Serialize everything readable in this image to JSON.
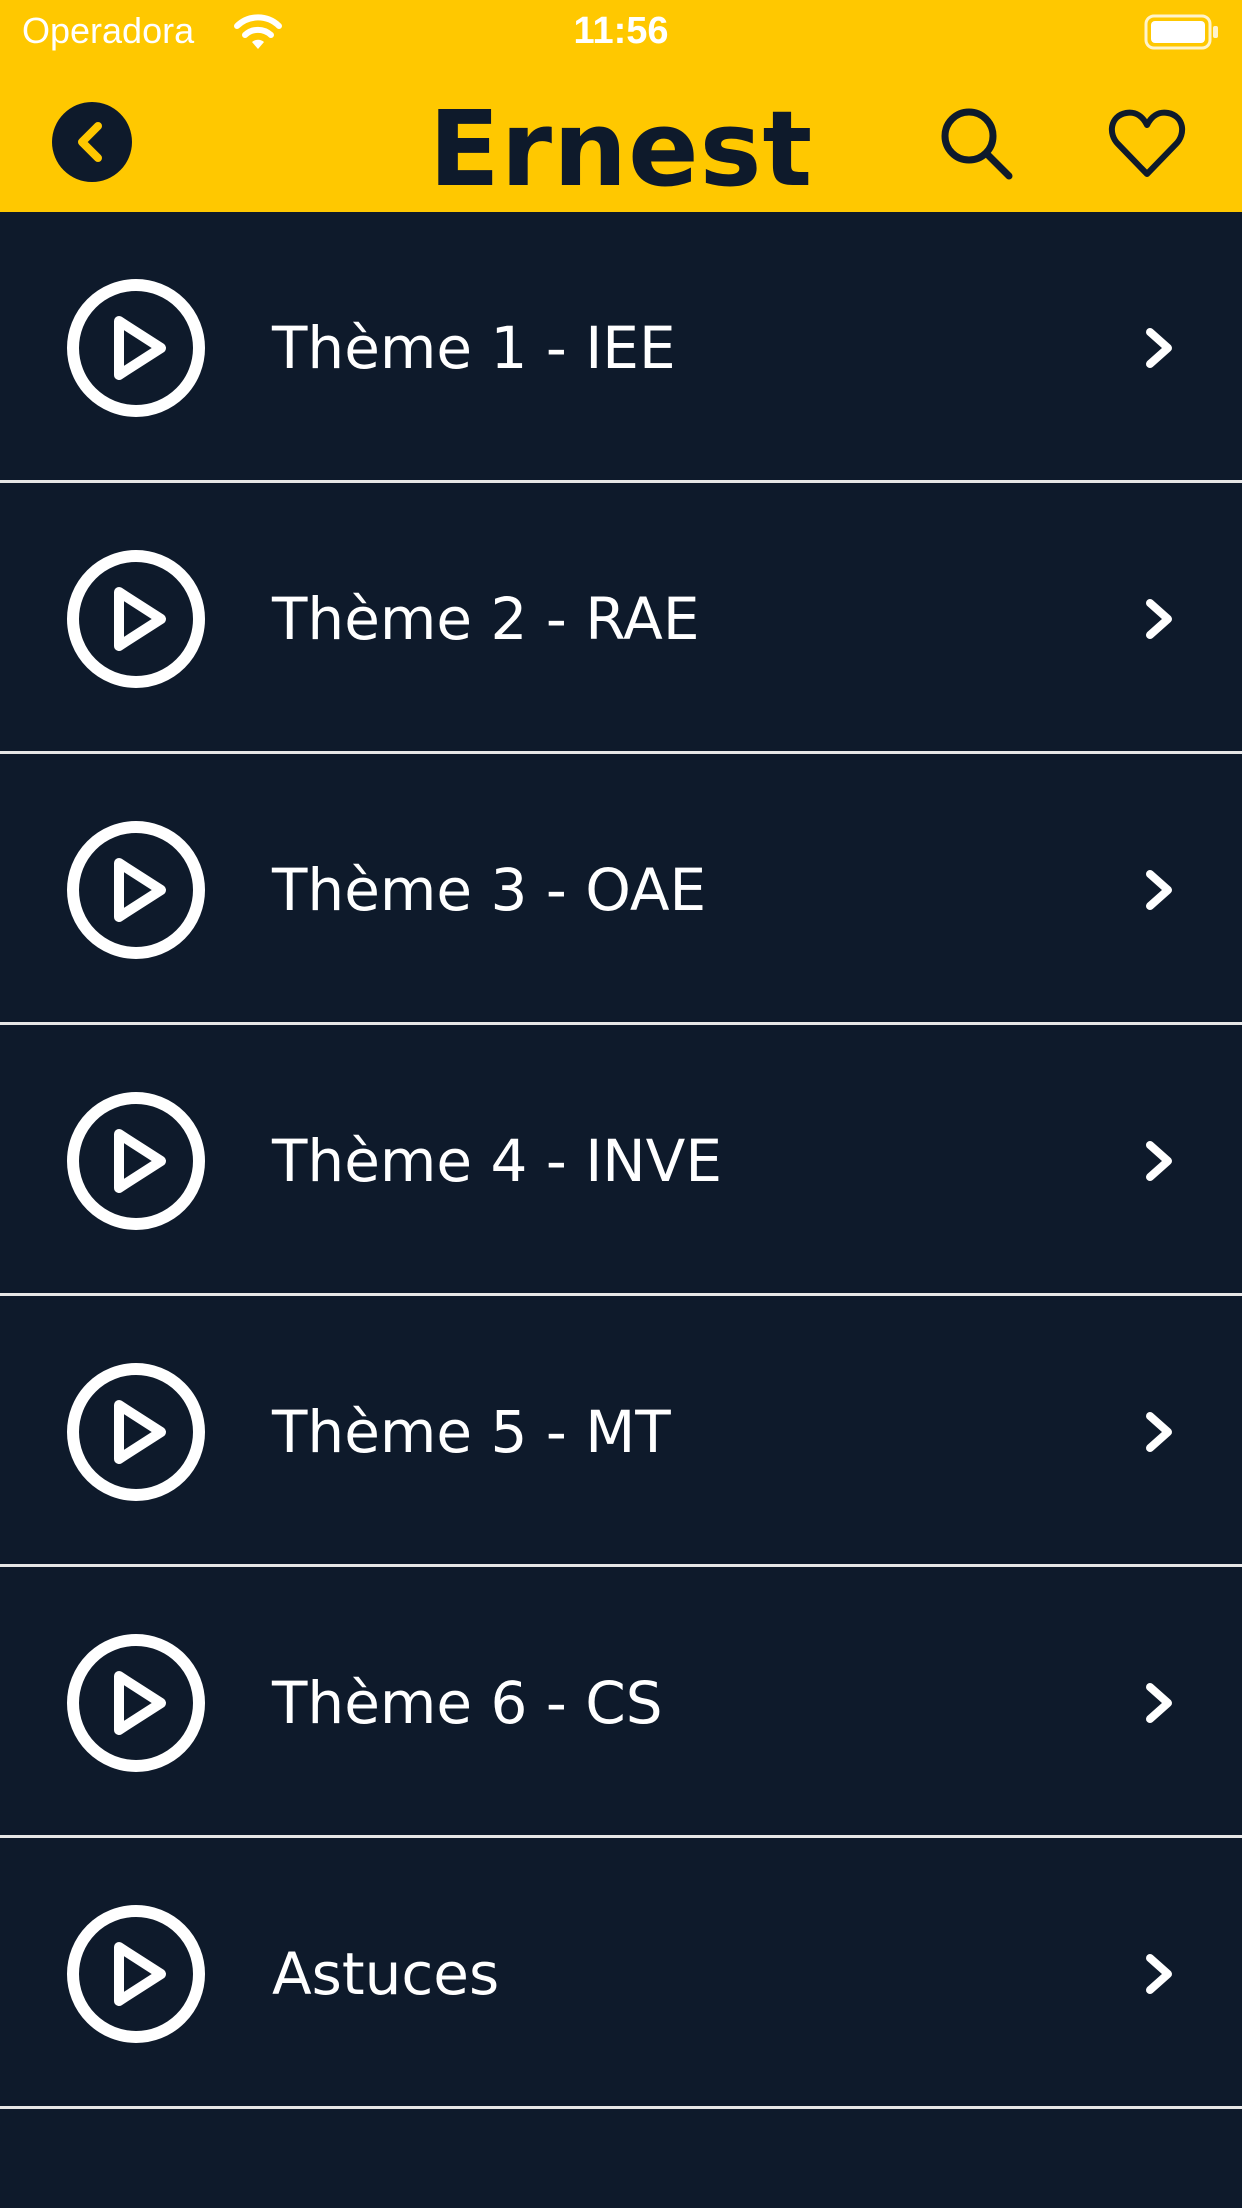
{
  "status_bar": {
    "carrier": "Operadora",
    "time": "11:56",
    "wifi_icon": "wifi-icon",
    "battery_icon": "battery-icon"
  },
  "nav": {
    "title": "Ernest",
    "back_icon": "chevron-left-circle-icon",
    "search_icon": "search-icon",
    "favorites_icon": "heart-icon"
  },
  "items": [
    {
      "label": "Thème 1 - IEE"
    },
    {
      "label": "Thème 2 - RAE"
    },
    {
      "label": "Thème 3 - OAE"
    },
    {
      "label": "Thème 4 - INVE"
    },
    {
      "label": "Thème 5 - MT"
    },
    {
      "label": "Thème 6 - CS"
    },
    {
      "label": "Astuces"
    }
  ],
  "colors": {
    "header_bg": "#FFC800",
    "content_bg": "#0E1A2B",
    "text_light": "#FFFFFF",
    "divider": "#E6E6E6"
  }
}
